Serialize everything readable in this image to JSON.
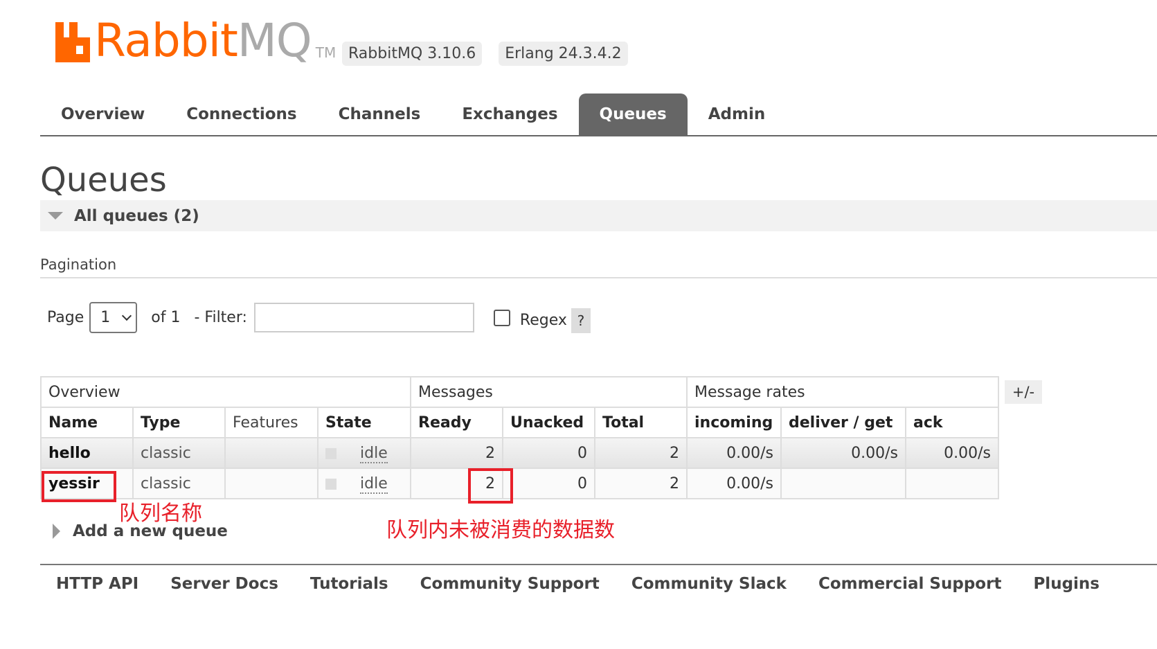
{
  "header": {
    "logo_rabbit": "Rabbit",
    "logo_mq": "MQ",
    "logo_tm": "TM",
    "version_rabbitmq": "RabbitMQ 3.10.6",
    "version_erlang": "Erlang 24.3.4.2",
    "brand_color": "#ff6600"
  },
  "nav": {
    "tabs": [
      "Overview",
      "Connections",
      "Channels",
      "Exchanges",
      "Queues",
      "Admin"
    ],
    "active": "Queues"
  },
  "page": {
    "title": "Queues",
    "section_title": "All queues (2)"
  },
  "pagination": {
    "label": "Pagination",
    "page_label": "Page",
    "page_value": "1",
    "of_label": "of 1",
    "filter_label": "- Filter:",
    "filter_value": "",
    "regex_label": "Regex",
    "regex_checked": false,
    "help": "?"
  },
  "table": {
    "groups": [
      "Overview",
      "Messages",
      "Message rates"
    ],
    "columns": [
      "Name",
      "Type",
      "Features",
      "State",
      "Ready",
      "Unacked",
      "Total",
      "incoming",
      "deliver / get",
      "ack"
    ],
    "toggle": "+/-",
    "rows": [
      {
        "name": "hello",
        "type": "classic",
        "features": "",
        "state": "idle",
        "ready": "2",
        "unacked": "0",
        "total": "2",
        "incoming": "0.00/s",
        "deliver_get": "0.00/s",
        "ack": "0.00/s"
      },
      {
        "name": "yessir",
        "type": "classic",
        "features": "",
        "state": "idle",
        "ready": "2",
        "unacked": "0",
        "total": "2",
        "incoming": "0.00/s",
        "deliver_get": "",
        "ack": ""
      }
    ]
  },
  "annotations": {
    "queue_name": "队列名称",
    "ready_note": "队列内未被消费的数据数",
    "color": "#e8202a"
  },
  "add_queue": "Add a new queue",
  "footer": {
    "links": [
      "HTTP API",
      "Server Docs",
      "Tutorials",
      "Community Support",
      "Community Slack",
      "Commercial Support",
      "Plugins"
    ]
  }
}
